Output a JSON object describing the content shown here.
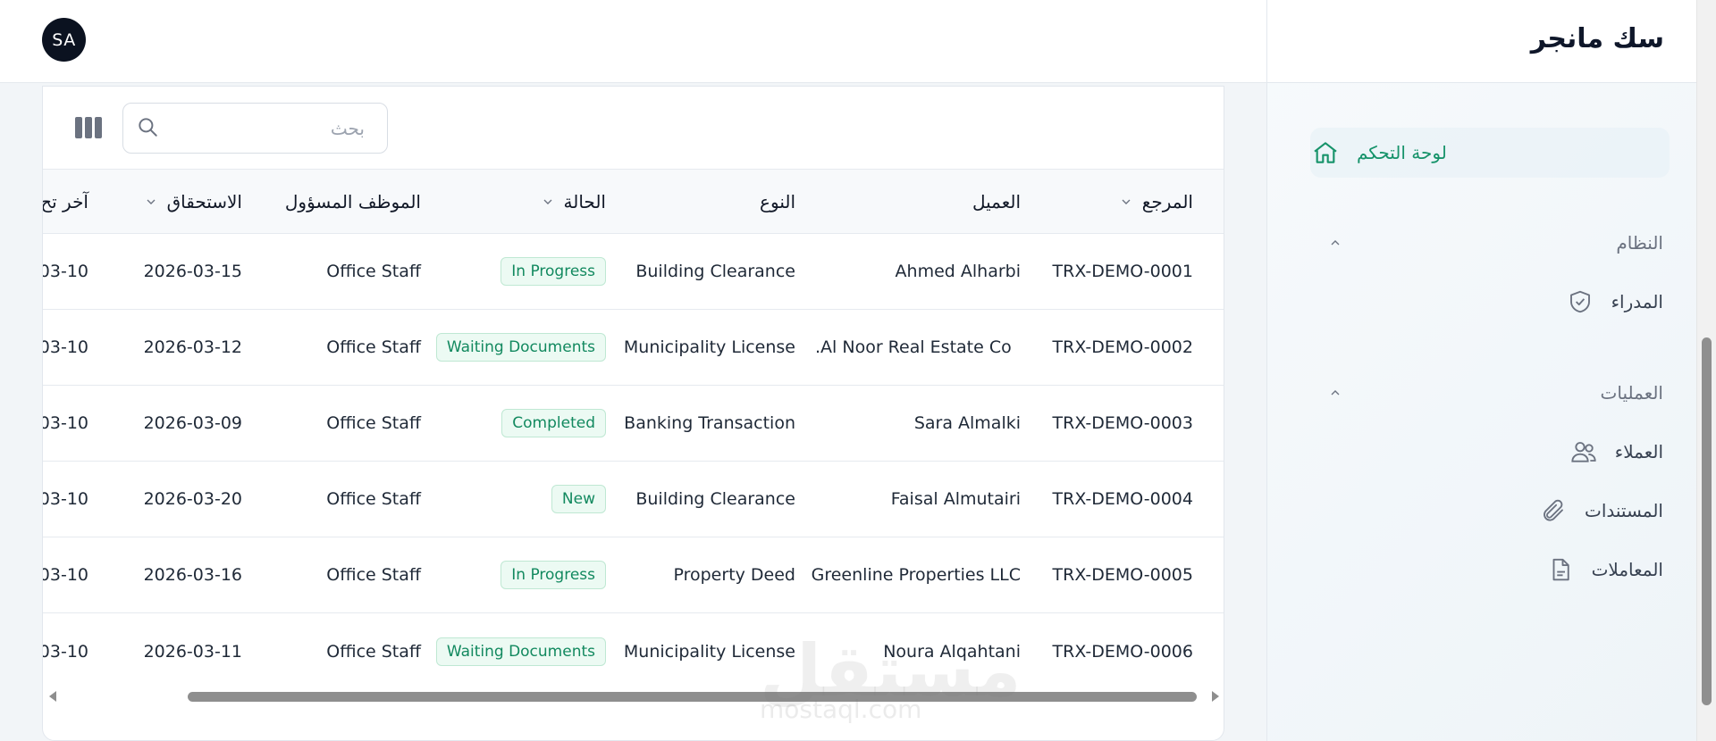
{
  "header": {
    "avatar_initials": "SA"
  },
  "sidebar": {
    "brand": "سك مانجر",
    "dashboard_label": "لوحة التحكم",
    "sections": [
      {
        "title": "النظام",
        "items": [
          {
            "label": "المدراء",
            "icon": "shield-check-icon"
          }
        ]
      },
      {
        "title": "العمليات",
        "items": [
          {
            "label": "العملاء",
            "icon": "users-icon"
          },
          {
            "label": "المستندات",
            "icon": "paperclip-icon"
          },
          {
            "label": "المعاملات",
            "icon": "document-icon"
          }
        ]
      }
    ]
  },
  "toolbar": {
    "search_placeholder": "بحث",
    "search_value": ""
  },
  "table": {
    "columns": {
      "reference": "المرجع",
      "client": "العميل",
      "type": "النوع",
      "status": "الحالة",
      "staff": "الموظف المسؤول",
      "due": "الاستحقاق",
      "last": "آخر تح"
    },
    "rows": [
      {
        "reference": "TRX-DEMO-0001",
        "client": "Ahmed Alharbi",
        "type": "Building Clearance",
        "status": "In Progress",
        "staff": "Office Staff",
        "due": "2026-03-15",
        "last": "03-10"
      },
      {
        "reference": "TRX-DEMO-0002",
        "client": "Al Noor Real Estate Co.",
        "type": "Municipality License",
        "status": "Waiting Documents",
        "staff": "Office Staff",
        "due": "2026-03-12",
        "last": "03-10"
      },
      {
        "reference": "TRX-DEMO-0003",
        "client": "Sara Almalki",
        "type": "Banking Transaction",
        "status": "Completed",
        "staff": "Office Staff",
        "due": "2026-03-09",
        "last": "03-10"
      },
      {
        "reference": "TRX-DEMO-0004",
        "client": "Faisal Almutairi",
        "type": "Building Clearance",
        "status": "New",
        "staff": "Office Staff",
        "due": "2026-03-20",
        "last": "03-10"
      },
      {
        "reference": "TRX-DEMO-0005",
        "client": "Greenline Properties LLC",
        "type": "Property Deed",
        "status": "In Progress",
        "staff": "Office Staff",
        "due": "2026-03-16",
        "last": "03-10"
      },
      {
        "reference": "TRX-DEMO-0006",
        "client": "Noura Alqahtani",
        "type": "Municipality License",
        "status": "Waiting Documents",
        "staff": "Office Staff",
        "due": "2026-03-11",
        "last": "03-10"
      }
    ]
  },
  "watermark": {
    "text": "مستقل",
    "subtext": "mostaql.com"
  },
  "colors": {
    "accent": "#16936a",
    "badge_bg": "#ecfaf3",
    "badge_border": "#bfe8d3"
  }
}
